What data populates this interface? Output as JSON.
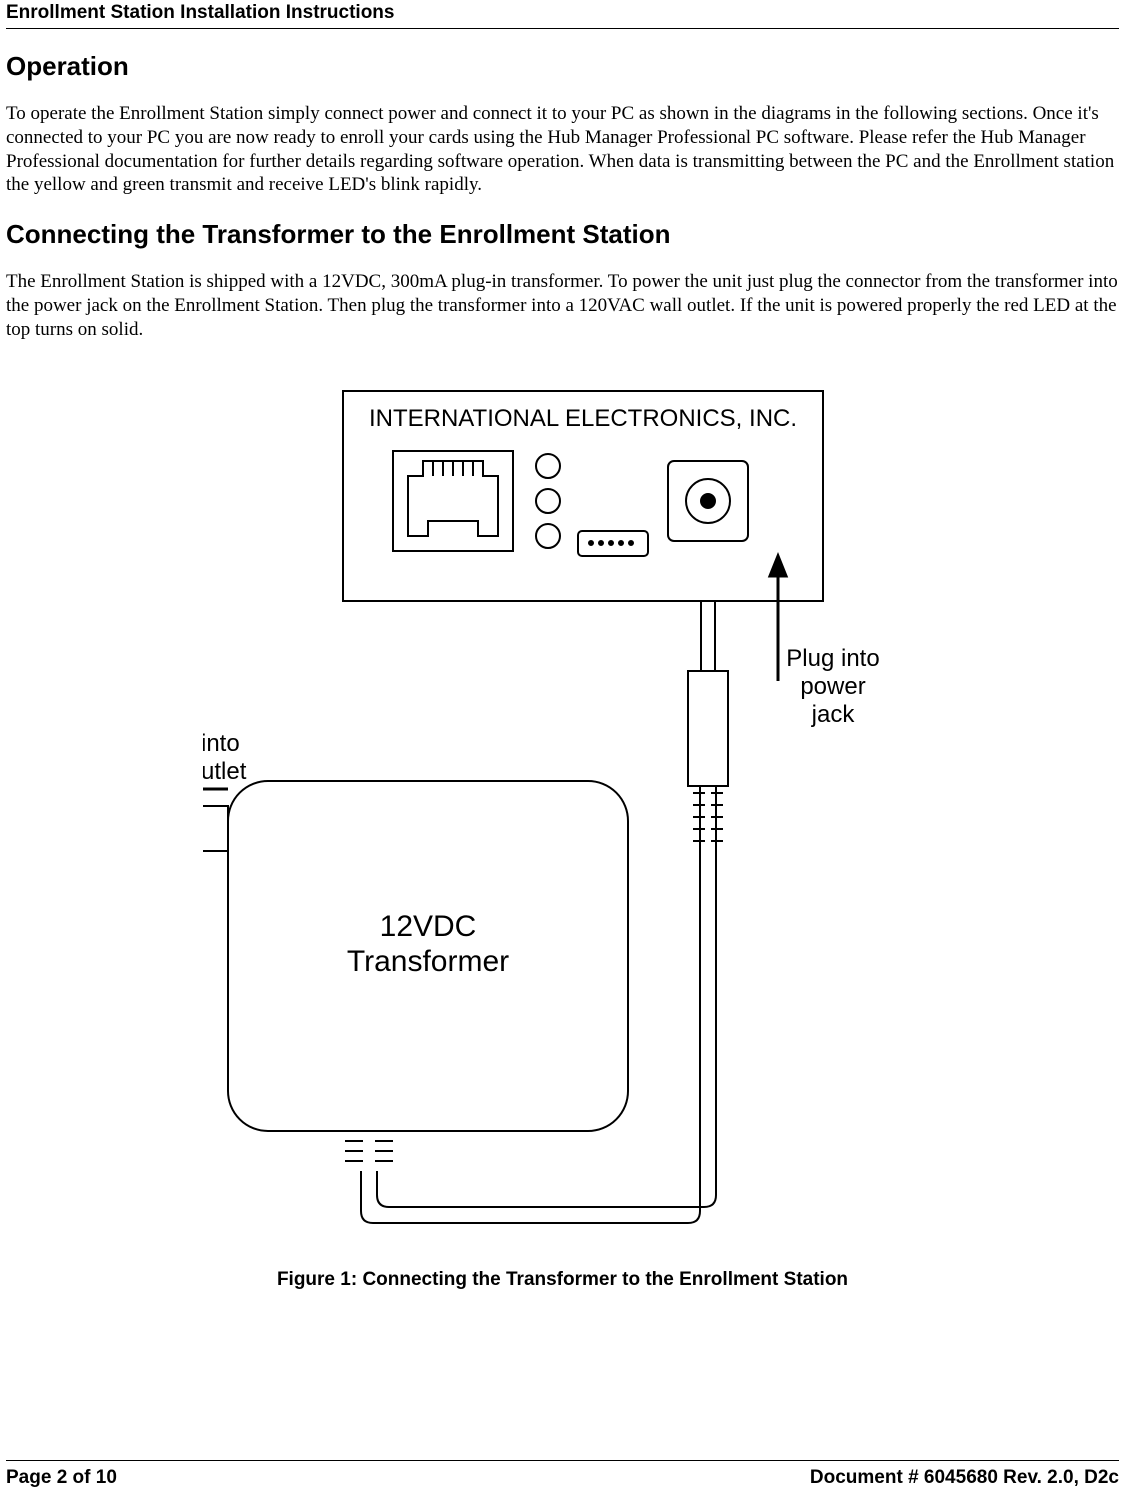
{
  "header": {
    "title": "Enrollment Station Installation Instructions"
  },
  "section1": {
    "heading": "Operation",
    "body": "To operate the Enrollment Station simply connect power and connect it to your PC as shown in the diagrams in the following sections. Once it's connected to your PC you are now ready to enroll your cards using the Hub Manager Professional PC software. Please refer the Hub Manager Professional documentation for further details regarding software operation. When data is transmitting between the PC and the Enrollment station the yellow and green transmit and receive LED's blink rapidly."
  },
  "section2": {
    "heading": "Connecting the Transformer to the Enrollment Station",
    "body": "The Enrollment Station is shipped with a 12VDC, 300mA plug-in transformer. To power the unit just plug the connector from the transformer into the power jack on the Enrollment Station. Then plug the transformer into a 120VAC wall outlet. If the unit is powered properly the red LED at the top turns on solid."
  },
  "figure": {
    "company": "INTERNATIONAL ELECTRONICS, INC.",
    "label_power_jack_l1": "Plug into",
    "label_power_jack_l2": "power",
    "label_power_jack_l3": "jack",
    "label_wall_l1": "Plug into",
    "label_wall_l2": "wall outlet",
    "transformer_l1": "12VDC",
    "transformer_l2": "Transformer",
    "caption": "Figure 1: Connecting the Transformer to the Enrollment Station"
  },
  "footer": {
    "page": "Page 2 of 10",
    "docnum": "Document # 6045680 Rev. 2.0, D2c"
  }
}
